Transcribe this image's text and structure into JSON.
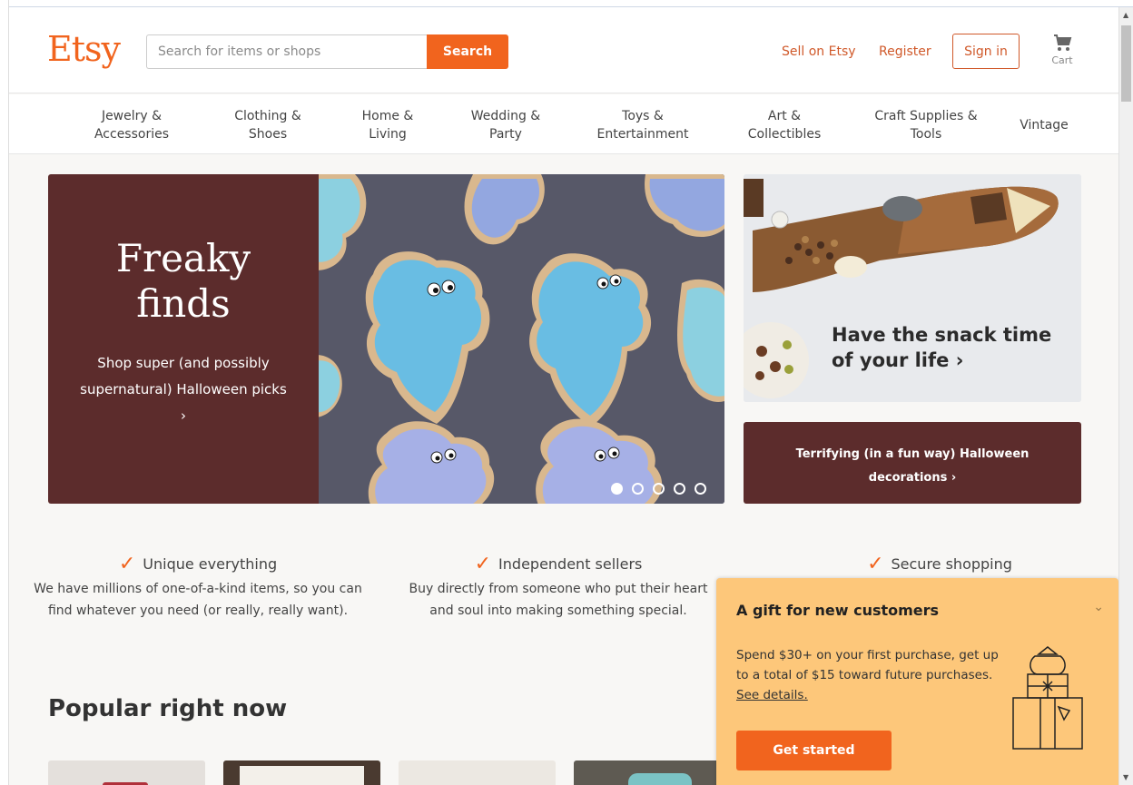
{
  "header": {
    "logo": "Etsy",
    "search_placeholder": "Search for items or shops",
    "search_button": "Search",
    "sell_link": "Sell on Etsy",
    "register_link": "Register",
    "signin_button": "Sign in",
    "cart_label": "Cart"
  },
  "nav": {
    "items": [
      {
        "line1": "Jewelry &",
        "line2": "Accessories"
      },
      {
        "line1": "Clothing &",
        "line2": "Shoes"
      },
      {
        "line1": "Home &",
        "line2": "Living"
      },
      {
        "line1": "Wedding &",
        "line2": "Party"
      },
      {
        "line1": "Toys &",
        "line2": "Entertainment"
      },
      {
        "line1": "Art &",
        "line2": "Collectibles"
      },
      {
        "line1": "Craft Supplies &",
        "line2": "Tools"
      },
      {
        "line1": "Vintage",
        "line2": ""
      }
    ]
  },
  "hero": {
    "title_line1": "Freaky",
    "title_line2": "finds",
    "subtitle": "Shop super (and possibly supernatural) Halloween picks ›",
    "slide_count": 5,
    "active_slide": 1
  },
  "snack": {
    "text": "Have the snack time of your life ›"
  },
  "decorations": {
    "text": "Terrifying (in a fun way) Halloween decorations ›"
  },
  "value_props": [
    {
      "title": "Unique everything",
      "body": "We have millions of one-of-a-kind items, so you can find whatever you need (or really, really want)."
    },
    {
      "title": "Independent sellers",
      "body": "Buy directly from someone who put their heart and soul into making something special."
    },
    {
      "title": "Secure shopping",
      "body": ""
    }
  ],
  "popular": {
    "heading": "Popular right now"
  },
  "gift": {
    "title": "A gift for new customers",
    "body": "Spend $30+ on your first purchase, get up to a total of $15 toward future purchases.",
    "link": "See details.",
    "button": "Get started"
  },
  "colors": {
    "brand": "#f1641e",
    "maroon": "#5c2c2c",
    "gift_bg": "#fdc77a"
  }
}
